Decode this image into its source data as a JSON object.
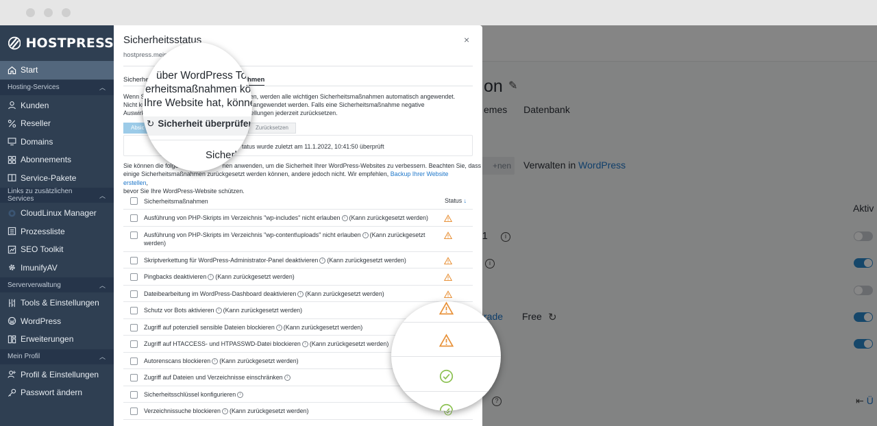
{
  "brand": {
    "name": "HOSTPRESS"
  },
  "sidebar": {
    "start": "Start",
    "sections": [
      {
        "label": "Hosting-Services",
        "items": [
          "Kunden",
          "Reseller",
          "Domains",
          "Abonnements",
          "Service-Pakete"
        ]
      },
      {
        "label": "Links zu zusätzlichen Services",
        "items": [
          "CloudLinux Manager",
          "Prozessliste",
          "SEO Toolkit",
          "ImunifyAV"
        ]
      },
      {
        "label": "Serververwaltung",
        "items": [
          "Tools & Einstellungen",
          "WordPress",
          "Erweiterungen"
        ]
      },
      {
        "label": "Mein Profil",
        "items": [
          "Profil & Einstellungen",
          "Passwort ändern"
        ]
      }
    ]
  },
  "background": {
    "title": "on",
    "tabs": [
      "emes",
      "Datenbank"
    ],
    "btn_partial": "+nen",
    "manage_prefix": "Verwalten in ",
    "manage_link": "WordPress",
    "active_col": "Aktiv",
    "version_partial": "2.1",
    "upgrade_partial": "rade",
    "free": "Free",
    "back_partial": "Ü"
  },
  "modal": {
    "title": "Sicherheitsstatus",
    "close": "×",
    "subtitle": "hostpress.meinwp.de",
    "tab1_partial": "Sicherheits",
    "tab2_partial": "eitsmaßnahmen",
    "desc": "Wenn Sie ... stallieren, werden alle wichtigen Sicherheitsmaßnahmen automatisch angewendet. Nicht k... manuell angewendet werden. Falls eine Sicherheitsmaßnahme negative Auswirk... ie Einstellungen jederzeit zurücksetzen.",
    "desc_lines": [
      "Wenn Si                                                   stallieren, werden alle wichtigen Sicherheitsmaßnahmen automatisch angewendet.",
      "Nicht kr                                                   manuell angewendet werden. Falls eine Sicherheitsmaßnahme negative",
      "Auswirk                                                   ie Einstellungen jederzeit zurücksetzen."
    ],
    "btn_apply_partial": "Absic",
    "btn_reset": "Zurücksetzen",
    "status_text": "tatus wurde zuletzt am 11.1.2022, 10:41:50 überprüft",
    "info_line1": "Sie können die folge                          nen anwenden, um die Sicherheit Ihrer WordPress-Websites zu verbessern. Beachten Sie, dass",
    "info_line2a": "einige Sicherheitsmaßnahmen zurückgesetzt werden können, andere jedoch nicht. Wir empfehlen, ",
    "info_link": "Backup Ihrer Website erstellen",
    "info_line2b": ",",
    "info_line3": "bevor Sie Ihre WordPress-Website schützen.",
    "table": {
      "col_measure": "Sicherheitsmaßnahmen",
      "col_status": "Status",
      "sort_arrow": "↓",
      "rows": [
        {
          "label": "Ausführung von PHP-Skripts im Verzeichnis \"wp-includes\" nicht erlauben",
          "note": "(Kann zurückgesetzt werden)",
          "status": "warning"
        },
        {
          "label": "Ausführung von PHP-Skripts im Verzeichnis \"wp-content\\uploads\" nicht erlauben",
          "note": "(Kann zurückgesetzt",
          "note2": "werden)",
          "status": "warning"
        },
        {
          "label": "Skriptverkettung für WordPress-Administrator-Panel deaktivieren",
          "note": "(Kann zurückgesetzt werden)",
          "status": "warning"
        },
        {
          "label": "Pingbacks deaktivieren",
          "note": "(Kann zurückgesetzt werden)",
          "status": "warning"
        },
        {
          "label": "Dateibearbeitung im WordPress-Dashboard deaktivieren",
          "note": "(Kann zurückgesetzt werden)",
          "status": "warning"
        },
        {
          "label": "Schutz vor Bots aktivieren",
          "note": "(Kann zurückgesetzt werden)",
          "status": "warning"
        },
        {
          "label": "Zugriff auf potenziell sensible Dateien blockieren",
          "note": "(Kann zurückgesetzt werden)",
          "status": "warning"
        },
        {
          "label": "Zugriff auf HTACCESS- und HTPASSWD-Datei blockieren",
          "note": "(Kann zurückgesetzt werden)",
          "status": "warning"
        },
        {
          "label": "Autorenscans blockieren",
          "note": "(Kann zurückgesetzt werden)",
          "status": "ok"
        },
        {
          "label": "Zugriff auf Dateien und Verzeichnisse einschränken",
          "note": "",
          "status": "ok"
        },
        {
          "label": "Sicherheitsschlüssel konfigurieren",
          "note": "",
          "status": "ok"
        },
        {
          "label": "Verzeichnissuche blockieren",
          "note": "(Kann zurückgesetzt werden)",
          "status": "ok"
        }
      ]
    }
  },
  "magnifier1": {
    "line1": "über WordPress To",
    "line2": "erheitsmaßnahmen kö",
    "line3": "Ihre Website hat, können",
    "button": "Sicherheit überprüfen",
    "line4": "Sicherh"
  },
  "colors": {
    "warning": "#e8923a",
    "ok": "#8cc152",
    "link": "#1d76c9",
    "sidebar": "#2f3f52"
  }
}
